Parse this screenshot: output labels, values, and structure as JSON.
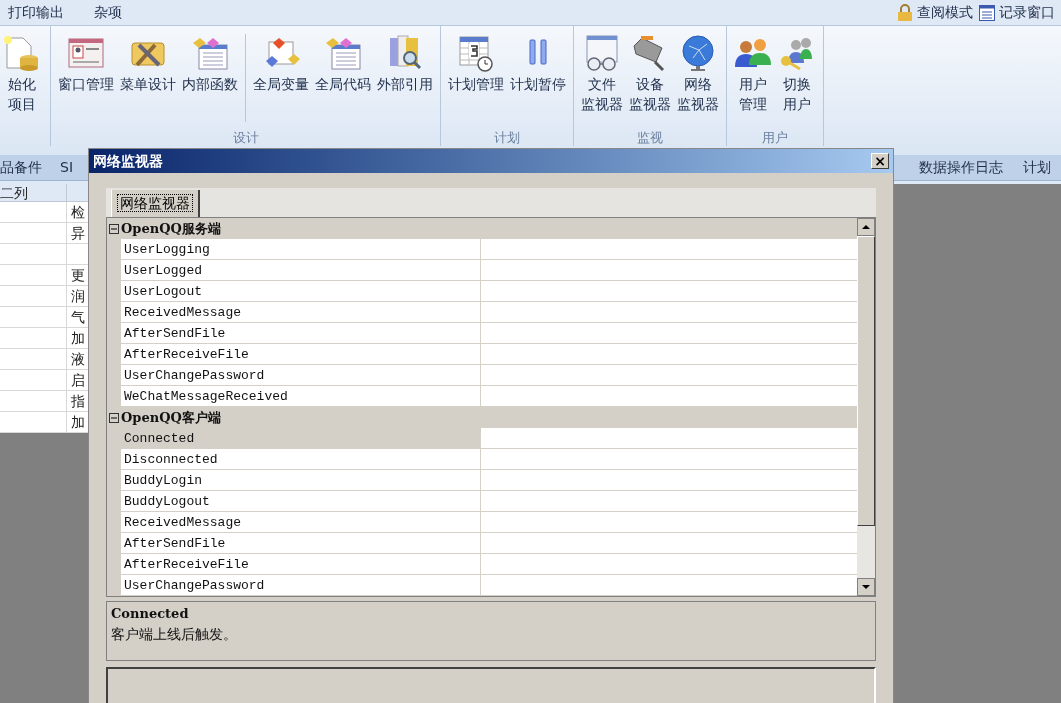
{
  "menu": [
    {
      "label": "打印输出"
    },
    {
      "label": "杂项"
    }
  ],
  "quick_actions": [
    {
      "label": "查阅模式"
    },
    {
      "label": "记录窗口"
    }
  ],
  "ribbon": {
    "groups": [
      {
        "sections": [
          [
            {
              "lines": [
                "始化",
                "项目"
              ]
            }
          ]
        ]
      },
      {
        "label": "设计",
        "sections": [
          [
            {
              "lines": [
                "窗口管理"
              ]
            },
            {
              "lines": [
                "菜单设计"
              ]
            },
            {
              "lines": [
                "内部函数"
              ]
            }
          ],
          [
            {
              "lines": [
                "全局变量"
              ]
            },
            {
              "lines": [
                "全局代码"
              ]
            },
            {
              "lines": [
                "外部引用"
              ]
            }
          ]
        ]
      },
      {
        "label": "计划",
        "sections": [
          [
            {
              "lines": [
                "计划管理"
              ]
            },
            {
              "lines": [
                "计划暂停"
              ]
            }
          ]
        ]
      },
      {
        "label": "监视",
        "sections": [
          [
            {
              "lines": [
                "文件",
                "监视器"
              ]
            },
            {
              "lines": [
                "设备",
                "监视器"
              ]
            },
            {
              "lines": [
                "网络",
                "监视器"
              ]
            }
          ]
        ]
      },
      {
        "label": "用户",
        "sections": [
          [
            {
              "lines": [
                "用户",
                "管理"
              ]
            },
            {
              "lines": [
                "切换",
                "用户"
              ]
            }
          ]
        ]
      }
    ]
  },
  "doc_tabs": {
    "left": [
      {
        "label": "品备件"
      },
      {
        "label": "SI"
      }
    ],
    "right": [
      {
        "label": "数据操作日志"
      },
      {
        "label": "计划"
      }
    ]
  },
  "grid": {
    "column_1": "二列",
    "rows": [
      {
        "column_2": "检"
      },
      {
        "column_2": "异"
      },
      {},
      {
        "column_2": "更"
      },
      {
        "column_2": "润"
      },
      {
        "column_2": "气"
      },
      {
        "column_2": "加"
      },
      {
        "column_2": "液"
      },
      {
        "column_2": "启"
      },
      {
        "column_2": "指"
      },
      {
        "column_2": "加"
      }
    ]
  },
  "dialog": {
    "title": "网络监视器",
    "close": "×",
    "tabs": [
      {
        "label": "网络监视器",
        "selected": true
      }
    ],
    "categories": [
      {
        "name": "OpenQQ服务端",
        "expanded": true,
        "items": [
          {
            "name": "UserLogging",
            "selected": false
          },
          {
            "name": "UserLogged",
            "selected": false
          },
          {
            "name": "UserLogout",
            "selected": false
          },
          {
            "name": "ReceivedMessage",
            "selected": false
          },
          {
            "name": "AfterSendFile",
            "selected": false
          },
          {
            "name": "AfterReceiveFile",
            "selected": false
          },
          {
            "name": "UserChangePassword",
            "selected": false
          },
          {
            "name": "WeChatMessageReceived",
            "selected": false
          }
        ]
      },
      {
        "name": "OpenQQ客户端",
        "expanded": true,
        "items": [
          {
            "name": "Connected",
            "selected": true
          },
          {
            "name": "Disconnected",
            "selected": false
          },
          {
            "name": "BuddyLogin",
            "selected": false
          },
          {
            "name": "BuddyLogout",
            "selected": false
          },
          {
            "name": "ReceivedMessage",
            "selected": false
          },
          {
            "name": "AfterSendFile",
            "selected": false
          },
          {
            "name": "AfterReceiveFile",
            "selected": false
          },
          {
            "name": "UserChangePassword",
            "selected": false
          }
        ]
      }
    ],
    "description": {
      "title": "Connected",
      "text": "客户端上线后触发。"
    }
  }
}
